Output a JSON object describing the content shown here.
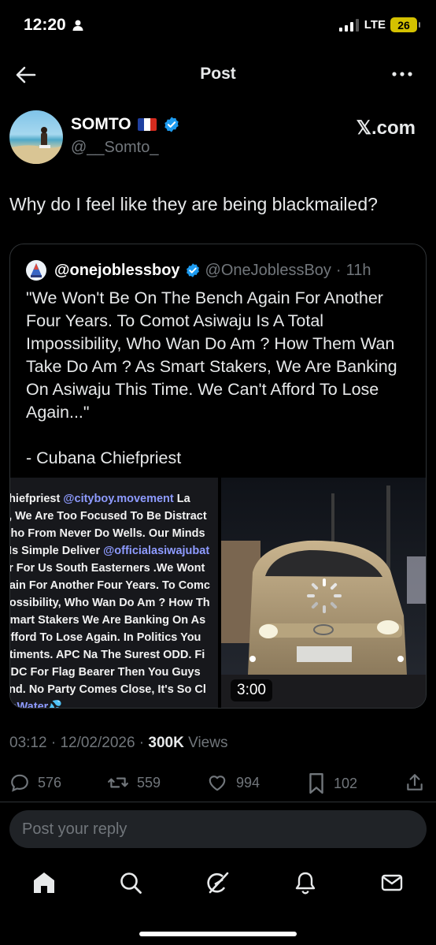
{
  "status_bar": {
    "time": "12:20",
    "network": "LTE",
    "battery": "26"
  },
  "header": {
    "title": "Post"
  },
  "author": {
    "name": "SOMTO",
    "handle": "@__Somto_",
    "source": "𝕏.com"
  },
  "post": {
    "text": "Why do I feel like they are being blackmailed?"
  },
  "quote": {
    "name": "@onejoblessboy",
    "handle": "@OneJoblessBoy",
    "separator": "·",
    "time": "11h",
    "text": "\"We Won't Be On The Bench Again For Another Four Years. To Comot Asiwaju Is A Total Impossibility, Who Wan Do Am ? How Them Wan Take Do Am ? As Smart Stakers, We Are Banking On Asiwaju This Time. We Can't Afford To Lose Again...\"\n\n- Cubana Chiefpriest",
    "image_lines": [
      {
        "a": "chiefpriest ",
        "b": "@cityboy.movement",
        "c": " La"
      },
      {
        "a": "s, We Are Too Focused To Be Distract",
        "b": "",
        "c": ""
      },
      {
        "a": "Cho From Never Do Wells. Our Minds",
        "b": "",
        "c": ""
      },
      {
        "a": "l Is Simple Deliver ",
        "b": "@officialasiwajubat",
        "c": ""
      },
      {
        "a": "er For Us South Easterners .We Wont",
        "b": "",
        "c": ""
      },
      {
        "a": "gain For Another Four Years. To Comc",
        "b": "",
        "c": ""
      },
      {
        "a": "possibility, Who Wan Do Am ? How Th",
        "b": "",
        "c": ""
      },
      {
        "a": "Smart Stakers We Are Banking On As",
        "b": "",
        "c": ""
      },
      {
        "a": "Afford To Lose Again. In Politics You",
        "b": "",
        "c": ""
      },
      {
        "a": "ntiments. APC Na The Surest ODD. Fi",
        "b": "",
        "c": ""
      },
      {
        "a": "ADC For Flag Bearer Then You Guys",
        "b": "",
        "c": ""
      },
      {
        "a": "and. No Party Comes Close, It's So Cl",
        "b": "",
        "c": ""
      },
      {
        "a": "",
        "b": "NaWater💦",
        "c": ""
      }
    ],
    "video_duration": "3:00"
  },
  "meta": {
    "time": "03:12",
    "dot1": " · ",
    "date": "12/02/2026",
    "dot2": " · ",
    "views_count": "300K",
    "views_label": " Views"
  },
  "actions": {
    "replies": "576",
    "reposts": "559",
    "likes": "994",
    "bookmarks": "102"
  },
  "reply_box": {
    "placeholder": "Post your reply"
  },
  "colors": {
    "accent": "#1d9bf0",
    "background": "#000000",
    "muted": "#71767b"
  },
  "icons": [
    "back-arrow-icon",
    "more-icon",
    "verified-icon",
    "reply-icon",
    "repost-icon",
    "like-icon",
    "bookmark-icon",
    "share-icon",
    "home-icon",
    "search-icon",
    "grok-icon",
    "notifications-icon",
    "messages-icon"
  ]
}
